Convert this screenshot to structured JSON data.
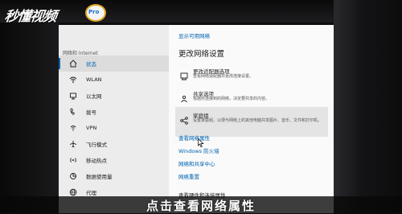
{
  "watermark": {
    "text": "秒懂视频",
    "logo_text": "Pro"
  },
  "sidebar": {
    "header": "网络和 Internet",
    "items": [
      {
        "label": "状态",
        "icon": "home-icon",
        "active": true
      },
      {
        "label": "WLAN",
        "icon": "wifi-icon"
      },
      {
        "label": "以太网",
        "icon": "ethernet-icon"
      },
      {
        "label": "拨号",
        "icon": "dialup-icon"
      },
      {
        "label": "VPN",
        "icon": "vpn-icon"
      },
      {
        "label": "飞行模式",
        "icon": "airplane-icon"
      },
      {
        "label": "移动热点",
        "icon": "hotspot-icon"
      },
      {
        "label": "数据使用量",
        "icon": "data-usage-icon"
      },
      {
        "label": "代理",
        "icon": "globe-icon"
      }
    ]
  },
  "main": {
    "top_link": "显示可用网络",
    "heading": "更改网络设置",
    "options": [
      {
        "title": "更改适配器选项",
        "desc": "查看网络适配器并更改连接设置。",
        "icon": "adapter-icon"
      },
      {
        "title": "共享选项",
        "desc": "根据所连接到的网络，决定要共享的内容。",
        "icon": "sharing-icon"
      },
      {
        "title": "家庭组",
        "desc": "设置家庭组，以便与网络上的其他电脑共享图片、音乐、文件和打印机。",
        "icon": "homegroup-icon"
      }
    ],
    "links": [
      "查看网络属性",
      "Windows 防火墙",
      "网络和共享中心",
      "网络重置"
    ],
    "partial_link": "查看硬件和连接属性"
  },
  "subtitle": "点击查看网络属性"
}
